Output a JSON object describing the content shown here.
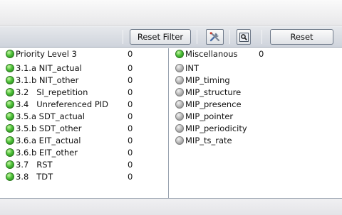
{
  "toolbar": {
    "reset_filter_label": "Reset Filter",
    "reset_label": "Reset",
    "tools_icon": "tools-icon",
    "zoom_icon": "zoom-icon"
  },
  "colors": {
    "status_ok": "#4fc23a",
    "status_inactive": "#b4b4b4",
    "toolbar_bg": "#d8dce2"
  },
  "left_list": {
    "header": {
      "label": "Priority Level 3",
      "count": "0",
      "status": "green"
    },
    "items": [
      {
        "label": "3.1.a NIT_actual",
        "count": "0",
        "status": "green"
      },
      {
        "label": "3.1.b NIT_other",
        "count": "0",
        "status": "green"
      },
      {
        "label": "3.2   SI_repetition",
        "count": "0",
        "status": "green"
      },
      {
        "label": "3.4   Unreferenced PID",
        "count": "0",
        "status": "green"
      },
      {
        "label": "3.5.a SDT_actual",
        "count": "0",
        "status": "green"
      },
      {
        "label": "3.5.b SDT_other",
        "count": "0",
        "status": "green"
      },
      {
        "label": "3.6.a EIT_actual",
        "count": "0",
        "status": "green"
      },
      {
        "label": "3.6.b EIT_other",
        "count": "0",
        "status": "green"
      },
      {
        "label": "3.7   RST",
        "count": "0",
        "status": "green"
      },
      {
        "label": "3.8   TDT",
        "count": "0",
        "status": "green"
      }
    ]
  },
  "right_list": {
    "header": {
      "label": "Miscellanous",
      "count": "0",
      "status": "green"
    },
    "items": [
      {
        "label": "INT",
        "status": "gray"
      },
      {
        "label": "MIP_timing",
        "status": "gray"
      },
      {
        "label": "MIP_structure",
        "status": "gray"
      },
      {
        "label": "MIP_presence",
        "status": "gray"
      },
      {
        "label": "MIP_pointer",
        "status": "gray"
      },
      {
        "label": "MIP_periodicity",
        "status": "gray"
      },
      {
        "label": "MIP_ts_rate",
        "status": "gray"
      }
    ]
  }
}
